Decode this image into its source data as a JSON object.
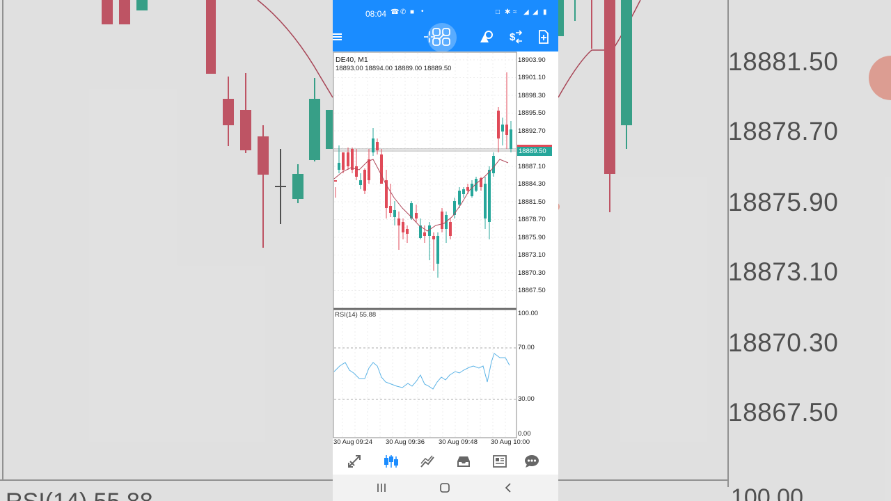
{
  "status_bar": {
    "time": "08:04",
    "icons": [
      "call-forward-icon",
      "call-icon",
      "video-icon",
      "dot-icon",
      "lock-icon",
      "bluetooth-icon",
      "wifi-icon",
      "signal-icon",
      "signal-icon",
      "battery-icon"
    ]
  },
  "toolbar": {
    "buttons": [
      "menu-icon",
      "crosshair-icon",
      "objects-icon",
      "shapes-icon",
      "trade-icon",
      "new-order-icon"
    ]
  },
  "chart": {
    "symbol": "DE40, M1",
    "ohlc": "18893.00 18894.00 18889.00 18889.50",
    "current_price": "18889.50",
    "price_labels": [
      "18903.90",
      "18901.10",
      "18898.30",
      "18895.50",
      "18892.70",
      "18887.10",
      "18884.30",
      "18881.50",
      "18878.70",
      "18875.90",
      "18873.10",
      "18870.30",
      "18867.50"
    ],
    "rsi_label": "RSI(14) 55.88",
    "rsi_ticks": [
      "100.00",
      "70.00",
      "30.00",
      "0.00"
    ],
    "time_labels": [
      "30 Aug 09:24",
      "30 Aug 09:36",
      "30 Aug 09:48",
      "30 Aug 10:00"
    ],
    "bull_color": "#26a69a",
    "bear_color": "#e04a58",
    "ma_color": "#b0485a",
    "rsi_color": "#5bb3e6"
  },
  "background": {
    "price_labels": [
      "18881.50",
      "18878.70",
      "18875.90",
      "18873.10",
      "18870.30",
      "18867.50"
    ],
    "rsi_text": "RSI(14) 55.88",
    "hundred": "100.00"
  },
  "bottom_nav": {
    "items": [
      "quotes-icon",
      "chart-icon",
      "trade-icon",
      "history-icon",
      "news-icon",
      "chat-icon"
    ],
    "active": "chart-icon",
    "accent": "#1a8cff"
  },
  "android_nav": {
    "items": [
      "recents-icon",
      "home-icon",
      "back-icon"
    ]
  }
}
